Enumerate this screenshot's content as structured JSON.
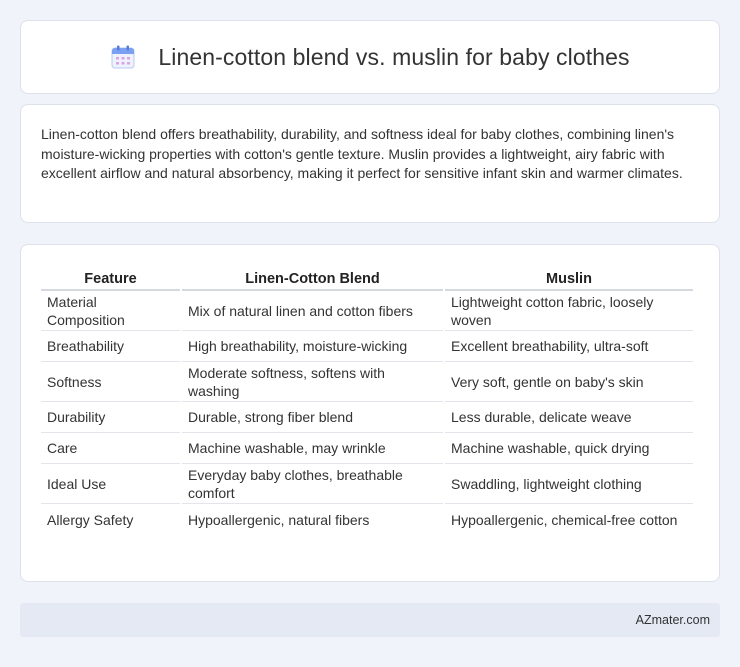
{
  "header": {
    "icon": "calendar-icon",
    "title": "Linen-cotton blend vs. muslin for baby clothes"
  },
  "intro": {
    "text": "Linen-cotton blend offers breathability, durability, and softness ideal for baby clothes, combining linen's moisture-wicking properties with cotton's gentle texture. Muslin provides a lightweight, airy fabric with excellent airflow and natural absorbency, making it perfect for sensitive infant skin and warmer climates."
  },
  "table": {
    "headers": [
      "Feature",
      "Linen-Cotton Blend",
      "Muslin"
    ],
    "rows": [
      [
        "Material Composition",
        "Mix of natural linen and cotton fibers",
        "Lightweight cotton fabric, loosely woven"
      ],
      [
        "Breathability",
        "High breathability, moisture-wicking",
        "Excellent breathability, ultra-soft"
      ],
      [
        "Softness",
        "Moderate softness, softens with washing",
        "Very soft, gentle on baby's skin"
      ],
      [
        "Durability",
        "Durable, strong fiber blend",
        "Less durable, delicate weave"
      ],
      [
        "Care",
        "Machine washable, may wrinkle",
        "Machine washable, quick drying"
      ],
      [
        "Ideal Use",
        "Everyday baby clothes, breathable comfort",
        "Swaddling, lightweight clothing"
      ],
      [
        "Allergy Safety",
        "Hypoallergenic, natural fibers",
        "Hypoallergenic, chemical-free cotton"
      ]
    ]
  },
  "footer": {
    "site": "AZmater.com"
  },
  "colors": {
    "background": "#f0f3f9",
    "card": "#ffffff",
    "footer_bg": "#e4e9f4",
    "icon_blue": "#5b8def",
    "icon_pink": "#e58fc0"
  }
}
